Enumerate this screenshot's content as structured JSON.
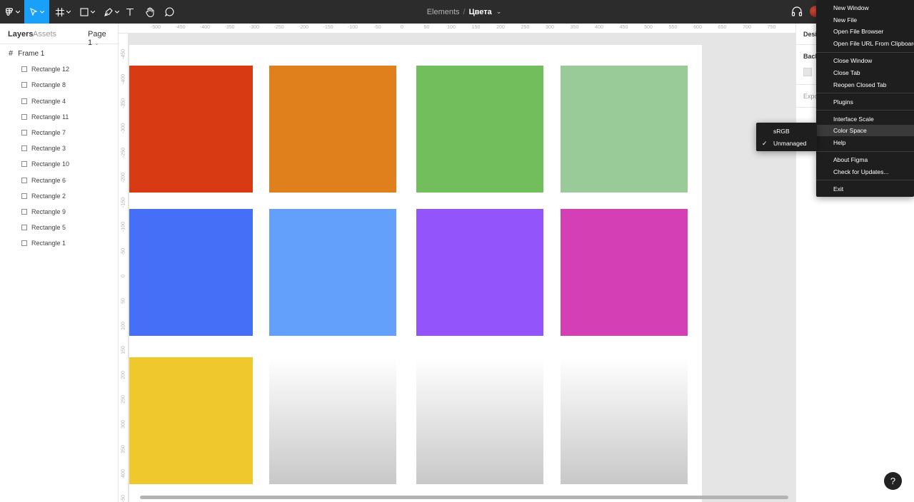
{
  "toolbar": {
    "project": "Elements",
    "separator": "/",
    "file": "Цвета"
  },
  "layers_panel": {
    "tab_layers": "Layers",
    "tab_assets": "Assets",
    "page": "Page 1",
    "frame": "Frame 1",
    "items": [
      "Rectangle 12",
      "Rectangle 8",
      "Rectangle 4",
      "Rectangle 11",
      "Rectangle 7",
      "Rectangle 3",
      "Rectangle 10",
      "Rectangle 6",
      "Rectangle 2",
      "Rectangle 9",
      "Rectangle 5",
      "Rectangle 1"
    ]
  },
  "ruler": {
    "top_labels": [
      "-500",
      "-450",
      "-400",
      "-350",
      "-300",
      "-250",
      "-200",
      "-150",
      "-100",
      "-50",
      "0",
      "50",
      "100",
      "150",
      "200",
      "250",
      "300",
      "350",
      "400",
      "450",
      "500",
      "550",
      "600",
      "650",
      "700",
      "750"
    ],
    "left_labels": [
      "-450",
      "-400",
      "-350",
      "-300",
      "-250",
      "-200",
      "-150",
      "-100",
      "-50",
      "0",
      "50",
      "100",
      "150",
      "200",
      "250",
      "300",
      "350",
      "400",
      "-50"
    ]
  },
  "canvas": {
    "swatches": [
      {
        "name": "Rectangle 12",
        "color": "#d83b13"
      },
      {
        "name": "Rectangle 8",
        "color": "#df801d"
      },
      {
        "name": "Rectangle 4",
        "color": "#73be5c"
      },
      {
        "name": "Rectangle 11",
        "color": "#98cb98"
      },
      {
        "name": "Rectangle 7",
        "color": "#456ff6"
      },
      {
        "name": "Rectangle 3",
        "color": "#63a0fb"
      },
      {
        "name": "Rectangle 10",
        "color": "#9354fb"
      },
      {
        "name": "Rectangle 6",
        "color": "#d53fb6"
      },
      {
        "name": "Rectangle 2",
        "color": "#eec82c"
      },
      {
        "name": "Rectangle 9",
        "color": "gradient"
      },
      {
        "name": "Rectangle 5",
        "color": "gradient"
      },
      {
        "name": "Rectangle 1",
        "color": "gradient"
      }
    ],
    "gradient_top": "#ffffff",
    "gradient_bottom": "#c8c8c8"
  },
  "right_panel": {
    "tab_design": "Desi",
    "background_label": "Back",
    "export_label": "Expo"
  },
  "main_menu": {
    "groups": [
      [
        "New Window",
        "New File",
        "Open File Browser",
        "Open File URL From Clipboard"
      ],
      [
        "Close Window",
        "Close Tab",
        "Reopen Closed Tab"
      ],
      [
        "Plugins"
      ],
      [
        "Interface Scale",
        "Color Space",
        "Help"
      ],
      [
        "About Figma",
        "Check for Updates..."
      ],
      [
        "Exit"
      ]
    ],
    "highlighted": "Color Space"
  },
  "color_space_submenu": {
    "items": [
      "sRGB",
      "Unmanaged"
    ],
    "checked": "Unmanaged"
  },
  "help_button": "?",
  "icons": [
    "figma-menu-icon",
    "move-tool-icon",
    "frame-tool-icon",
    "rectangle-tool-icon",
    "pen-tool-icon",
    "text-tool-icon",
    "hand-tool-icon",
    "comment-icon",
    "headphones-icon",
    "avatar",
    "frame-grid-icon",
    "rectangle-layer-icon",
    "checkmark-icon",
    "help-icon"
  ]
}
